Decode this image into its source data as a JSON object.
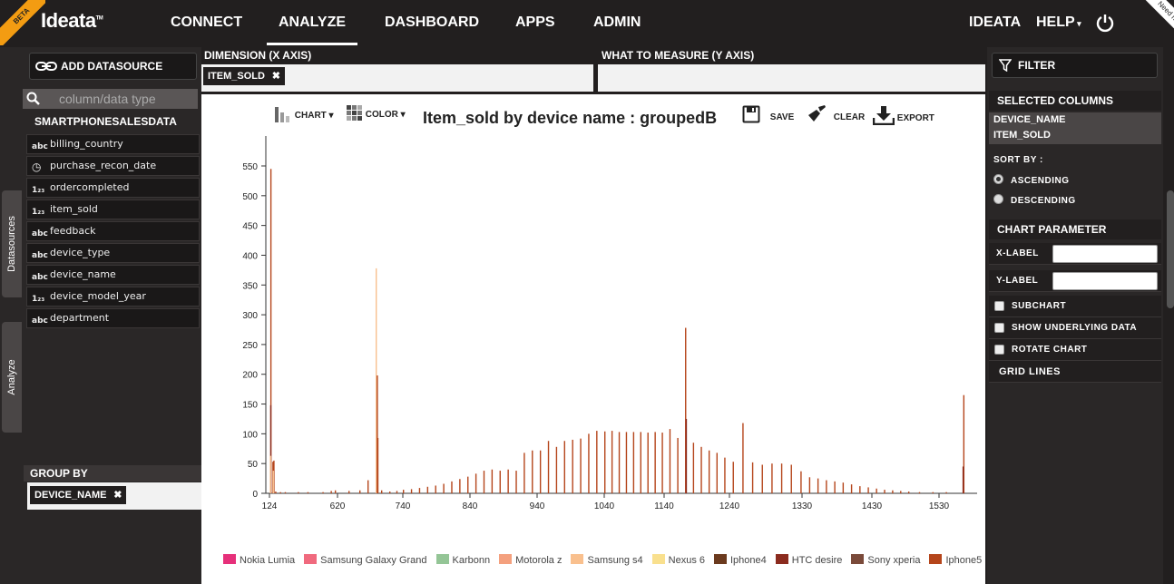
{
  "header": {
    "beta_label": "BETA",
    "logo": "Ideata",
    "logo_tm": "TM",
    "nav": [
      "CONNECT",
      "ANALYZE",
      "DASHBOARD",
      "APPS",
      "ADMIN"
    ],
    "active_nav": "ANALYZE",
    "user": "IDEATA",
    "help": "HELP",
    "need_help": "Need help"
  },
  "left": {
    "side_tabs": [
      "Datasources",
      "Analyze"
    ],
    "add_datasource": "ADD DATASOURCE",
    "search_placeholder": "column/data type",
    "datasource_name": "SMARTPHONESALESDATA",
    "columns": [
      {
        "name": "billing_country",
        "type": "text"
      },
      {
        "name": "purchase_recon_date",
        "type": "date"
      },
      {
        "name": "ordercompleted",
        "type": "number"
      },
      {
        "name": "item_sold",
        "type": "number"
      },
      {
        "name": "feedback",
        "type": "text"
      },
      {
        "name": "device_type",
        "type": "text"
      },
      {
        "name": "device_name",
        "type": "text"
      },
      {
        "name": "device_model_year",
        "type": "number"
      },
      {
        "name": "department",
        "type": "text"
      }
    ],
    "group_by_label": "GROUP BY",
    "group_by_value": "DEVICE_NAME"
  },
  "axes": {
    "dimension_label": "DIMENSION (X AXIS)",
    "dimension_value": "ITEM_SOLD",
    "measure_label": "WHAT TO MEASURE (Y AXIS)"
  },
  "toolbar": {
    "chart": "CHART",
    "color": "COLOR",
    "save": "SAVE",
    "clear": "CLEAR",
    "export": "EXPORT"
  },
  "chart_data": {
    "type": "bar",
    "title": "Item_sold by device name : groupedB",
    "xlabel": "",
    "ylabel": "",
    "x_ticks": [
      124,
      620,
      740,
      840,
      940,
      1040,
      1140,
      1240,
      1330,
      1430,
      1530
    ],
    "y_ticks": [
      0,
      50,
      100,
      150,
      200,
      250,
      300,
      350,
      400,
      450,
      500,
      550
    ],
    "ylim": [
      0,
      600
    ],
    "legend": [
      {
        "name": "Nokia Lumia",
        "color": "#e6307a"
      },
      {
        "name": "Samsung Galaxy Grand",
        "color": "#f06a7e"
      },
      {
        "name": "Karbonn",
        "color": "#94c596"
      },
      {
        "name": "Motorola z",
        "color": "#f4a07e"
      },
      {
        "name": "Samsung s4",
        "color": "#f9c08e"
      },
      {
        "name": "Nexus 6",
        "color": "#f9e08e"
      },
      {
        "name": "Iphone4",
        "color": "#6b3a1e"
      },
      {
        "name": "HTC desire",
        "color": "#8b2b1e"
      },
      {
        "name": "Sony xperia",
        "color": "#7a4a3a"
      },
      {
        "name": "Iphone5",
        "color": "#b5451b"
      }
    ],
    "bars": [
      {
        "x": 130,
        "y": 545,
        "series": "Iphone5"
      },
      {
        "x": 129,
        "y": 148,
        "series": "HTC desire"
      },
      {
        "x": 127,
        "y": 63,
        "series": "Samsung s4"
      },
      {
        "x": 145,
        "y": 53,
        "series": "Iphone5"
      },
      {
        "x": 152,
        "y": 55,
        "series": "Iphone5"
      },
      {
        "x": 150,
        "y": 30,
        "series": "Iphone5"
      },
      {
        "x": 148,
        "y": 38,
        "series": "Samsung s4"
      },
      {
        "x": 165,
        "y": 3,
        "series": "Iphone5"
      },
      {
        "x": 200,
        "y": 2,
        "series": "Iphone5"
      },
      {
        "x": 235,
        "y": 2,
        "series": "Iphone5"
      },
      {
        "x": 330,
        "y": 2,
        "series": "Iphone5"
      },
      {
        "x": 400,
        "y": 2,
        "series": "Iphone5"
      },
      {
        "x": 510,
        "y": 2,
        "series": "Iphone5"
      },
      {
        "x": 570,
        "y": 4,
        "series": "Iphone5"
      },
      {
        "x": 600,
        "y": 5,
        "series": "Iphone5"
      },
      {
        "x": 640,
        "y": 4,
        "series": "Iphone5"
      },
      {
        "x": 660,
        "y": 5,
        "series": "Iphone5"
      },
      {
        "x": 675,
        "y": 22,
        "series": "Iphone5"
      },
      {
        "x": 690,
        "y": 378,
        "series": "Samsung s4"
      },
      {
        "x": 692,
        "y": 198,
        "series": "Iphone5"
      },
      {
        "x": 693,
        "y": 93,
        "series": "Iphone5"
      },
      {
        "x": 700,
        "y": 5,
        "series": "Iphone5"
      },
      {
        "x": 715,
        "y": 3,
        "series": "Iphone5"
      },
      {
        "x": 728,
        "y": 4,
        "series": "Iphone5"
      },
      {
        "x": 740,
        "y": 6,
        "series": "Iphone5"
      },
      {
        "x": 752,
        "y": 7,
        "series": "Iphone5"
      },
      {
        "x": 764,
        "y": 9,
        "series": "Iphone5"
      },
      {
        "x": 776,
        "y": 11,
        "series": "Iphone5"
      },
      {
        "x": 788,
        "y": 13,
        "series": "Iphone5"
      },
      {
        "x": 800,
        "y": 16,
        "series": "Iphone5"
      },
      {
        "x": 812,
        "y": 20,
        "series": "Iphone5"
      },
      {
        "x": 824,
        "y": 24,
        "series": "Iphone5"
      },
      {
        "x": 836,
        "y": 28,
        "series": "Iphone5"
      },
      {
        "x": 848,
        "y": 33,
        "series": "Iphone5"
      },
      {
        "x": 860,
        "y": 38,
        "series": "Iphone5"
      },
      {
        "x": 872,
        "y": 40,
        "series": "Iphone5"
      },
      {
        "x": 884,
        "y": 38,
        "series": "Iphone5"
      },
      {
        "x": 896,
        "y": 40,
        "series": "Iphone5"
      },
      {
        "x": 908,
        "y": 38,
        "series": "Iphone5"
      },
      {
        "x": 920,
        "y": 68,
        "series": "Iphone5"
      },
      {
        "x": 932,
        "y": 72,
        "series": "Iphone5"
      },
      {
        "x": 944,
        "y": 72,
        "series": "Iphone5"
      },
      {
        "x": 956,
        "y": 88,
        "series": "Iphone5"
      },
      {
        "x": 968,
        "y": 78,
        "series": "Iphone5"
      },
      {
        "x": 980,
        "y": 88,
        "series": "Iphone5"
      },
      {
        "x": 992,
        "y": 90,
        "series": "Iphone5"
      },
      {
        "x": 1004,
        "y": 92,
        "series": "Iphone5"
      },
      {
        "x": 1016,
        "y": 100,
        "series": "Iphone5"
      },
      {
        "x": 1028,
        "y": 105,
        "series": "Iphone5"
      },
      {
        "x": 1040,
        "y": 104,
        "series": "Iphone5"
      },
      {
        "x": 1052,
        "y": 105,
        "series": "Iphone5"
      },
      {
        "x": 1064,
        "y": 103,
        "series": "Iphone5"
      },
      {
        "x": 1076,
        "y": 103,
        "series": "Iphone5"
      },
      {
        "x": 1088,
        "y": 103,
        "series": "Iphone5"
      },
      {
        "x": 1100,
        "y": 103,
        "series": "Iphone5"
      },
      {
        "x": 1112,
        "y": 102,
        "series": "Iphone5"
      },
      {
        "x": 1124,
        "y": 103,
        "series": "Iphone5"
      },
      {
        "x": 1136,
        "y": 102,
        "series": "Iphone5"
      },
      {
        "x": 1148,
        "y": 108,
        "series": "Iphone5"
      },
      {
        "x": 1160,
        "y": 93,
        "series": "Iphone5"
      },
      {
        "x": 1172,
        "y": 278,
        "series": "Iphone5"
      },
      {
        "x": 1173,
        "y": 125,
        "series": "HTC desire"
      },
      {
        "x": 1184,
        "y": 85,
        "series": "Iphone5"
      },
      {
        "x": 1196,
        "y": 78,
        "series": "Iphone5"
      },
      {
        "x": 1208,
        "y": 72,
        "series": "Iphone5"
      },
      {
        "x": 1220,
        "y": 68,
        "series": "Iphone5"
      },
      {
        "x": 1232,
        "y": 60,
        "series": "Iphone5"
      },
      {
        "x": 1244,
        "y": 53,
        "series": "Iphone5"
      },
      {
        "x": 1256,
        "y": 118,
        "series": "Iphone5"
      },
      {
        "x": 1268,
        "y": 52,
        "series": "Iphone5"
      },
      {
        "x": 1280,
        "y": 48,
        "series": "Iphone5"
      },
      {
        "x": 1292,
        "y": 50,
        "series": "Iphone5"
      },
      {
        "x": 1304,
        "y": 50,
        "series": "Iphone5"
      },
      {
        "x": 1316,
        "y": 48,
        "series": "Iphone5"
      },
      {
        "x": 1328,
        "y": 37,
        "series": "Iphone5"
      },
      {
        "x": 1340,
        "y": 27,
        "series": "Iphone5"
      },
      {
        "x": 1352,
        "y": 25,
        "series": "Iphone5"
      },
      {
        "x": 1364,
        "y": 22,
        "series": "Iphone5"
      },
      {
        "x": 1376,
        "y": 20,
        "series": "Iphone5"
      },
      {
        "x": 1388,
        "y": 18,
        "series": "Iphone5"
      },
      {
        "x": 1400,
        "y": 15,
        "series": "Iphone5"
      },
      {
        "x": 1412,
        "y": 12,
        "series": "Iphone5"
      },
      {
        "x": 1424,
        "y": 10,
        "series": "Iphone5"
      },
      {
        "x": 1436,
        "y": 8,
        "series": "Iphone5"
      },
      {
        "x": 1448,
        "y": 6,
        "series": "Iphone5"
      },
      {
        "x": 1460,
        "y": 5,
        "series": "Iphone5"
      },
      {
        "x": 1472,
        "y": 4,
        "series": "Iphone5"
      },
      {
        "x": 1484,
        "y": 3,
        "series": "Iphone5"
      },
      {
        "x": 1500,
        "y": 2,
        "series": "Iphone5"
      },
      {
        "x": 1520,
        "y": 2,
        "series": "Iphone5"
      },
      {
        "x": 1540,
        "y": 2,
        "series": "Iphone5"
      },
      {
        "x": 1566,
        "y": 165,
        "series": "Iphone5"
      },
      {
        "x": 1565,
        "y": 45,
        "series": "HTC desire"
      }
    ]
  },
  "right": {
    "filter": "FILTER",
    "selected_columns_label": "SELECTED COLUMNS",
    "selected_columns": [
      "DEVICE_NAME",
      "ITEM_SOLD"
    ],
    "sort_by": "SORT BY :",
    "ascending": "ASCENDING",
    "descending": "DESCENDING",
    "sort_selected": "ascending",
    "chart_parameter": "CHART PARAMETER",
    "x_label": "X-LABEL",
    "y_label": "Y-LABEL",
    "subchart": "SUBCHART",
    "show_underlying": "SHOW UNDERLYING DATA",
    "rotate_chart": "ROTATE CHART",
    "grid_lines": "GRID LINES"
  }
}
